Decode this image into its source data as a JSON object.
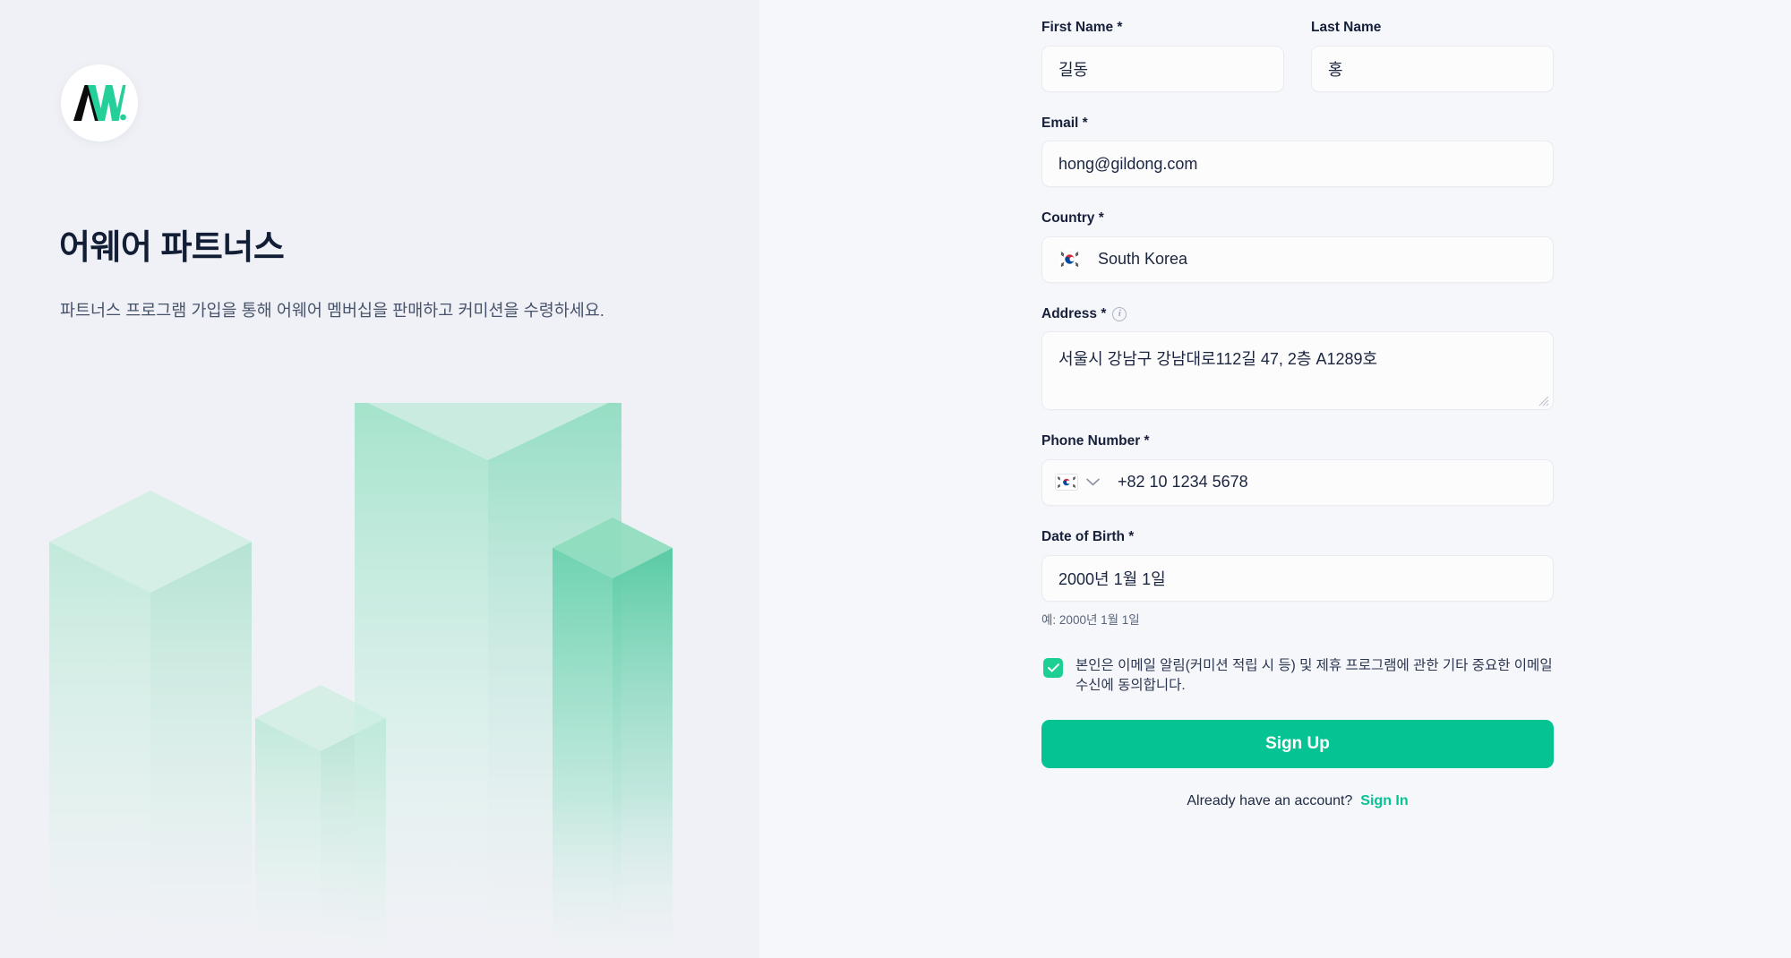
{
  "brand": {
    "logo_icon": "aware-aw-logo-icon",
    "logo_mark_text": "AW.",
    "title": "어웨어 파트너스",
    "subtitle": "파트너스 프로그램 가입을 통해 어웨어 멤버십을 판매하고 커미션을 수령하세요."
  },
  "colors": {
    "accent_green": "#06c394",
    "checkbox_green": "#1dcf92",
    "left_panel_bg": "#f0f1f6",
    "right_panel_bg": "#f6f7fb",
    "input_bg": "#fcfcfd",
    "input_border": "#e9ebf1",
    "heading_text": "#121e36",
    "body_text": "#47536b",
    "illustration_mint": "#8fe0c4"
  },
  "form": {
    "first_name": {
      "label": "First Name *",
      "value": "길동"
    },
    "last_name": {
      "label": "Last Name",
      "value": "홍"
    },
    "email": {
      "label": "Email *",
      "value": "hong@gildong.com"
    },
    "country": {
      "label": "Country *",
      "value": "South Korea",
      "flag_icon": "south-korea-flag-icon"
    },
    "address": {
      "label": "Address *",
      "info_icon": "info-circle-icon",
      "value": "서울시 강남구 강남대로112길 47, 2층 A1289호"
    },
    "phone": {
      "label": "Phone Number *",
      "value": "+82 10 1234 5678",
      "flag_icon": "south-korea-flag-icon",
      "dropdown_icon": "chevron-down-icon"
    },
    "date_of_birth": {
      "label": "Date of Birth *",
      "value": "2000년 1월 1일",
      "helper": "예: 2000년 1월 1일"
    },
    "consent": {
      "checked": true,
      "check_icon": "checkmark-icon",
      "text": "본인은 이메일 알림(커미션 적립 시 등) 및 제휴 프로그램에 관한 기타 중요한 이메일 수신에 동의합니다."
    },
    "submit": {
      "label": "Sign Up"
    },
    "footer": {
      "prompt": "Already have an account?",
      "link": "Sign In"
    }
  },
  "illustration": {
    "type": "isometric-bar-chart",
    "bars": [
      4,
      1,
      6,
      2
    ]
  }
}
